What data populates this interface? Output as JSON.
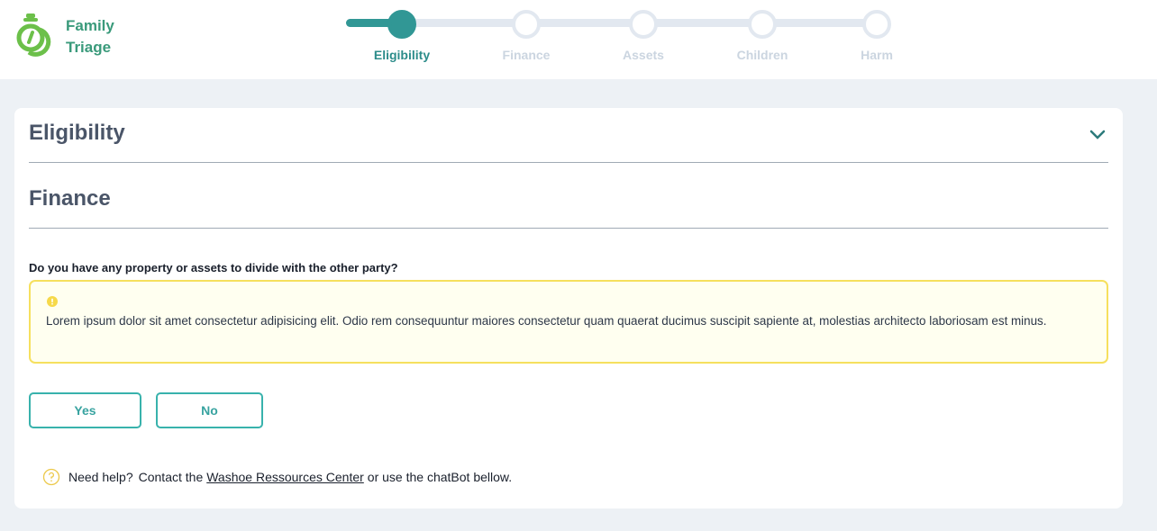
{
  "app": {
    "logo_line1": "Family",
    "logo_line2": "Triage",
    "logo_icon": "rings-icon",
    "brand_color": "#6cc04a",
    "accent_color": "#319795"
  },
  "stepper": {
    "current_index": 0,
    "steps": [
      {
        "label": "Eligibility",
        "state": "active"
      },
      {
        "label": "Finance",
        "state": "pending"
      },
      {
        "label": "Assets",
        "state": "pending"
      },
      {
        "label": "Children",
        "state": "pending"
      },
      {
        "label": "Harm",
        "state": "pending"
      }
    ]
  },
  "sections": [
    {
      "title": "Eligibility",
      "toggle_icon": "chevron-down-icon"
    },
    {
      "title": "Finance"
    }
  ],
  "question": {
    "text": "Do you have any property or assets to divide with the other party?",
    "alert_icon": "exclamation-circle-icon",
    "alert_text": "Lorem ipsum dolor sit amet consectetur adipisicing elit. Odio rem consequuntur maiores consectetur quam quaerat ducimus suscipit sapiente at, molestias architecto laboriosam est minus.",
    "options": [
      {
        "label": "Yes"
      },
      {
        "label": "No"
      }
    ]
  },
  "help": {
    "icon": "question-circle-icon",
    "prefix": "Need help?",
    "middle": "Contact the",
    "link_text": "Washoe Ressources Center",
    "suffix": "or use the chatBot bellow."
  }
}
